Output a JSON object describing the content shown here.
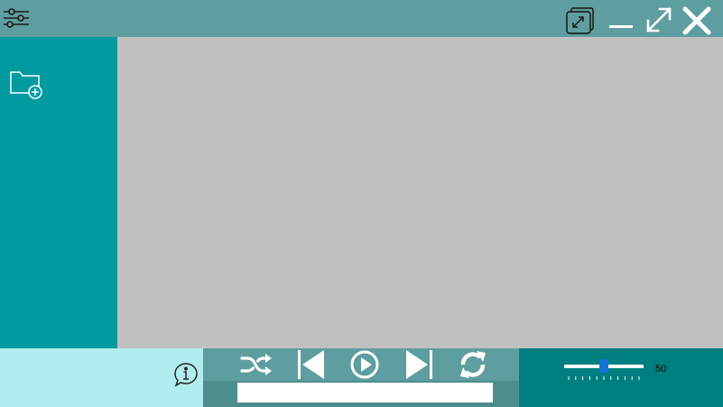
{
  "colors": {
    "titlebar": "#5f9ea0",
    "sidebar": "#009aa0",
    "content": "#c0c0c0",
    "info_panel": "#b0ecf0",
    "controls_panel": "#5f9ea0",
    "progress_strip": "#4e8d8e",
    "volume_panel": "#007f80",
    "volume_thumb": "#1874d4"
  },
  "titlebar": {
    "icons": [
      "settings-sliders-icon",
      "restore-window-icon",
      "minimize-icon",
      "maximize-icon",
      "close-icon"
    ]
  },
  "sidebar": {
    "icons": [
      "add-folder-icon"
    ]
  },
  "info": {
    "icons": [
      "info-bubble-icon"
    ]
  },
  "player": {
    "icons": [
      "shuffle-icon",
      "previous-icon",
      "play-icon",
      "next-icon",
      "repeat-icon"
    ],
    "progress": 0
  },
  "volume": {
    "value": "50",
    "level": 0.5
  }
}
